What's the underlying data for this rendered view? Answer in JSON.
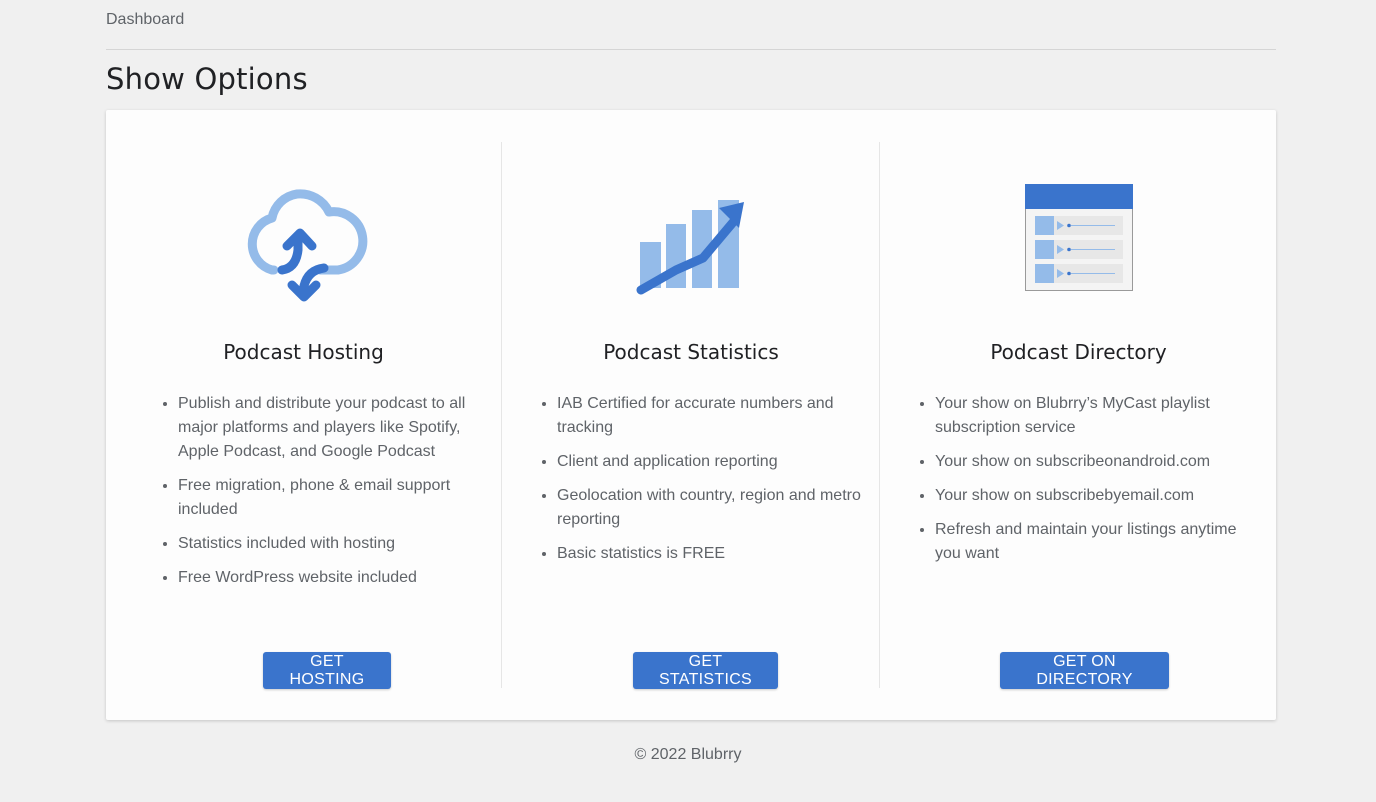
{
  "breadcrumb": "Dashboard",
  "page_title": "Show Options",
  "colors": {
    "accent": "#3a74cc",
    "icon_light": "#94bbe9",
    "icon_dark": "#3a74cc"
  },
  "columns": [
    {
      "title": "Podcast Hosting",
      "icon": "cloud-sync-icon",
      "features": [
        "Publish and distribute your podcast to all major platforms and players like Spotify, Apple Podcast, and Google Podcast",
        "Free migration, phone & email support included",
        "Statistics included with hosting",
        "Free WordPress website included"
      ],
      "button": "GET HOSTING"
    },
    {
      "title": "Podcast Statistics",
      "icon": "bar-chart-trend-icon",
      "features": [
        "IAB Certified for accurate numbers and tracking",
        "Client and application reporting",
        "Geolocation with country, region and metro reporting",
        "Basic statistics is FREE"
      ],
      "button": "GET STATISTICS"
    },
    {
      "title": "Podcast Directory",
      "icon": "playlist-directory-icon",
      "features": [
        "Your show on Blubrry’s MyCast playlist subscription service",
        "Your show on subscribeonandroid.com",
        "Your show on subscribebyemail.com",
        "Refresh and maintain your listings anytime you want"
      ],
      "button": "GET ON DIRECTORY"
    }
  ],
  "footer": "© 2022 Blubrry"
}
